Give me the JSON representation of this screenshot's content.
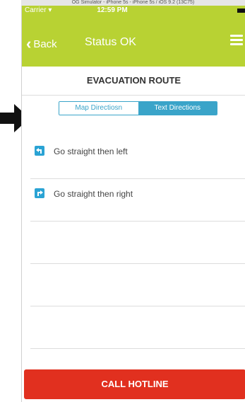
{
  "simulator_title": "OG Simulator - iPhone 5s - iPhone 5s / iOS 9.2 (13C75)",
  "statusbar": {
    "carrier": "Carrier",
    "time": "12:59 PM"
  },
  "navbar": {
    "back_label": "Back",
    "title": "Status OK"
  },
  "section_title": "EVACUATION ROUTE",
  "segmented": {
    "map_label": "Map Directiosn",
    "text_label": "Text Directions",
    "selected": "text"
  },
  "directions": [
    {
      "icon": "turn-left-icon",
      "text": "Go straight then left"
    },
    {
      "icon": "turn-right-icon",
      "text": "Go straight then right"
    }
  ],
  "hotline_label": "CALL HOTLINE",
  "colors": {
    "brand": "#b8d233",
    "accent": "#3aa4c9",
    "danger": "#e1301f"
  }
}
